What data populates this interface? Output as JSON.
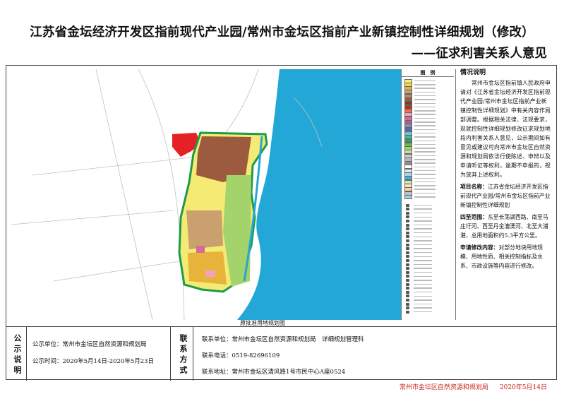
{
  "title": "江苏省金坛经济开发区指前现代产业园/常州市金坛区指前产业新镇控制性详细规划（修改）",
  "subtitle": "——征求利害关系人意见",
  "map_caption": "原批准用地规划图",
  "legend": {
    "header": "图　例",
    "colors": [
      "#f4f07a",
      "#f6d25a",
      "#e8b33a",
      "#c9a06e",
      "#b7866a",
      "#9c5b3e",
      "#7a3f2a",
      "#c1272d",
      "#e8734a",
      "#f2a3b8",
      "#d66b9a",
      "#b65f8b",
      "#7c8fc2",
      "#4f6fb0",
      "#6cc3c9",
      "#4bb3a8",
      "#2c9b6b",
      "#6fbe44",
      "#a4d36b",
      "#c7e39b",
      "#d6c6e3",
      "#b9b9b9",
      "#8f8f8f",
      "#ffffff",
      "#e6e6e6",
      "#a7d8e8",
      "#3fb2d8",
      "#cfe8a8",
      "#f7e3c0",
      "#ffd59a",
      "#c0c0c0",
      "#9fd0f0"
    ],
    "symbol_count": 28
  },
  "side": {
    "header": "情况说明",
    "body": "常州市金坛区指前镇人民政府申请对《江苏省金坛经济开发区指前现代产业园/常州市金坛区指前产业新镇控制性详细规划》中有关内容作局部调整。根据相关法律、法规要求，现就控制性详细规划修改征求规划地段内利害关系人意见，公示期间如有意见或建议可向常州市金坛区自然资源和规划局依法行使陈述、申辩以及申请听证等权利，逾期不申报的，视为放弃上述权利。",
    "items": [
      {
        "label": "项目名称：",
        "text": "江苏省金坛经济开发区指前现代产业园/常州市金坛区指前产业新镇控制性详细规划"
      },
      {
        "label": "四至范围：",
        "text": "东至长荡湖西路、南至马庄圩河、西至丹金漕溧河、北至大浦港，总用地面积约5.3平方公里。"
      },
      {
        "label": "申请修改内容：",
        "text": "对部分地块用地规模、用地性质、相关控制指标及水系、市政设施等内容进行修改。"
      }
    ]
  },
  "bottom": {
    "publicity_label": "公示说明",
    "unit": "公示单位：常州市金坛区自然资源和规划局",
    "time": "公示时间：2020年5月14日-2020年5月23日",
    "contact_label": "联系方式",
    "contact_unit": "联系单位：常州市金坛区自然资源和规划局　详细规划管理科",
    "phone": "联系电话：0519-82696109",
    "address": "联系地址：常州市金坛区清风路1号市民中心A座0524"
  },
  "footer": {
    "org": "常州市金坛区自然资源和规划局",
    "date": "2020年5月14日"
  },
  "colors": {
    "lake": "#23a7d6",
    "footer_red": "#c8281e"
  }
}
